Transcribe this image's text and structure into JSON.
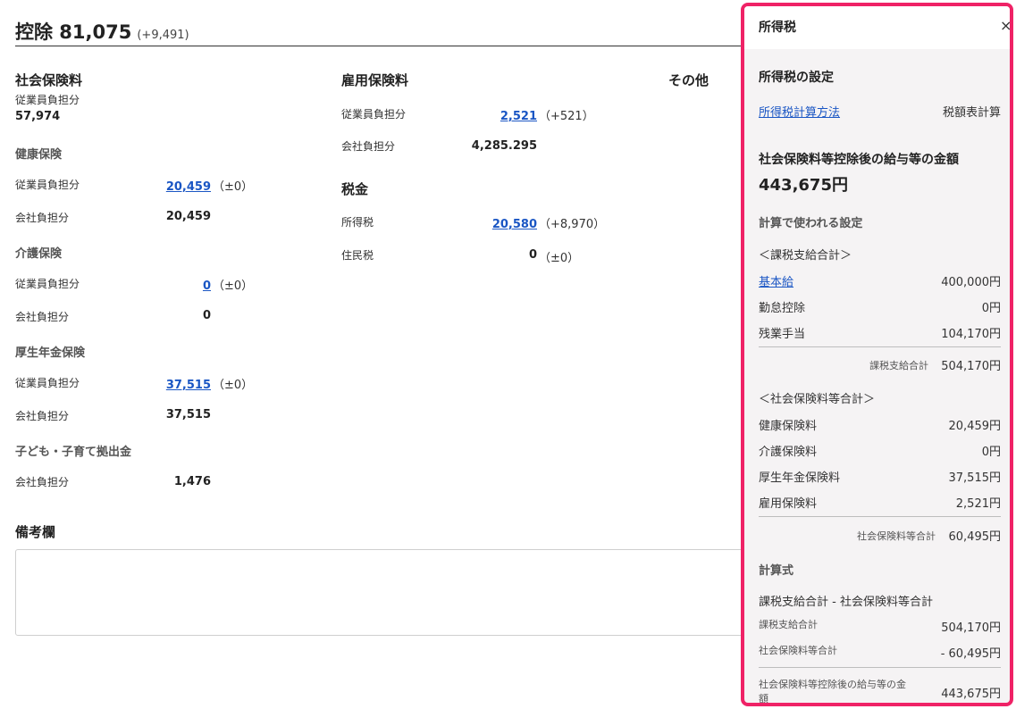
{
  "header": {
    "title": "控除 81,075",
    "delta": "(+9,491)"
  },
  "social_insurance": {
    "title": "社会保険料",
    "employee_label": "従業員負担分",
    "employee_total": "57,974",
    "health": {
      "title": "健康保険",
      "employee_label": "従業員負担分",
      "employee_value": "20,459",
      "employee_delta": "（±0）",
      "company_label": "会社負担分",
      "company_value": "20,459"
    },
    "care": {
      "title": "介護保険",
      "employee_label": "従業員負担分",
      "employee_value": "0",
      "employee_delta": "（±0）",
      "company_label": "会社負担分",
      "company_value": "0"
    },
    "pension": {
      "title": "厚生年金保険",
      "employee_label": "従業員負担分",
      "employee_value": "37,515",
      "employee_delta": "（±0）",
      "company_label": "会社負担分",
      "company_value": "37,515"
    },
    "child": {
      "title": "子ども・子育て拠出金",
      "company_label": "会社負担分",
      "company_value": "1,476"
    }
  },
  "employment": {
    "title": "雇用保険料",
    "employee_label": "従業員負担分",
    "employee_value": "2,521",
    "employee_delta": "（+521）",
    "company_label": "会社負担分",
    "company_value": "4,285.295"
  },
  "tax": {
    "title": "税金",
    "income_label": "所得税",
    "income_value": "20,580",
    "income_delta": "（+8,970）",
    "resident_label": "住民税",
    "resident_value": "0",
    "resident_delta": "（±0）"
  },
  "other": {
    "title": "その他"
  },
  "notes": {
    "title": "備考欄"
  },
  "panel": {
    "title": "所得税",
    "close": "×",
    "settings_title": "所得税の設定",
    "method_link": "所得税計算方法",
    "method_value": "税額表計算",
    "after_title": "社会保険料等控除後の給与等の金額",
    "after_amount": "443,675円",
    "calc_settings": "計算で使われる設定",
    "taxable_header": "＜課税支給合計＞",
    "taxable_items": [
      {
        "label": "基本給",
        "value": "400,000円",
        "link": true
      },
      {
        "label": "勤怠控除",
        "value": "0円",
        "link": false
      },
      {
        "label": "残業手当",
        "value": "104,170円",
        "link": false
      }
    ],
    "taxable_total_label": "課税支給合計",
    "taxable_total_value": "504,170円",
    "social_header": "＜社会保険料等合計＞",
    "social_items": [
      {
        "label": "健康保険料",
        "value": "20,459円"
      },
      {
        "label": "介護保険料",
        "value": "0円"
      },
      {
        "label": "厚生年金保険料",
        "value": "37,515円"
      },
      {
        "label": "雇用保険料",
        "value": "2,521円"
      }
    ],
    "social_total_label": "社会保険料等合計",
    "social_total_value": "60,495円",
    "formula_title": "計算式",
    "formula": "課税支給合計 - 社会保険料等合計",
    "formula_rows": [
      {
        "label": "課税支給合計",
        "value": "504,170円"
      },
      {
        "label": "社会保険料等合計",
        "value": "- 60,495円"
      }
    ],
    "result_label_line1": "社会保険料等控除後の給与等の金",
    "result_label_line2": "額",
    "result_value": "443,675円"
  }
}
